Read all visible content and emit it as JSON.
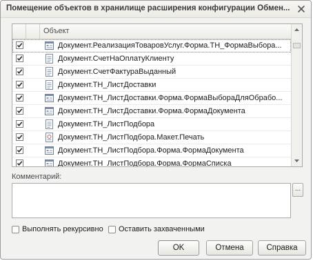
{
  "window": {
    "title": "Помещение объектов в хранилище расширения конфигурации Обмен..."
  },
  "grid": {
    "column_object": "Объект",
    "rows": [
      {
        "checked": true,
        "icon": "form-icon",
        "text": "Документ.РеализацияТоваровУслуг.Форма.ТН_ФормаВыбора..."
      },
      {
        "checked": true,
        "icon": "document-icon",
        "text": "Документ.СчетНаОплатуКлиенту"
      },
      {
        "checked": true,
        "icon": "document-icon",
        "text": "Документ.СчетФактураВыданный"
      },
      {
        "checked": true,
        "icon": "document-icon",
        "text": "Документ.ТН_ЛистДоставки"
      },
      {
        "checked": true,
        "icon": "form-icon",
        "text": "Документ.ТН_ЛистДоставки.Форма.ФормаВыбораДляОбрабо..."
      },
      {
        "checked": true,
        "icon": "form-icon",
        "text": "Документ.ТН_ЛистДоставки.Форма.ФормаДокумента"
      },
      {
        "checked": true,
        "icon": "document-icon",
        "text": "Документ.ТН_ЛистПодбора"
      },
      {
        "checked": true,
        "icon": "template-icon",
        "text": "Документ.ТН_ЛистПодбора.Макет.Печать"
      },
      {
        "checked": true,
        "icon": "form-icon",
        "text": "Документ.ТН_ЛистПодбора.Форма.ФормаДокумента"
      },
      {
        "checked": true,
        "icon": "form-icon",
        "text": "Документ.ТН_ЛистПодбора.Форма.ФормаСписка"
      }
    ]
  },
  "comment": {
    "label": "Комментарий:",
    "value": "",
    "ellipsis_label": "..."
  },
  "options": {
    "recursive_label": "Выполнять рекурсивно",
    "recursive_checked": false,
    "keep_captured_label": "Оставить захваченными",
    "keep_captured_checked": false
  },
  "buttons": {
    "ok": "OK",
    "cancel": "Отмена",
    "help": "Справка"
  }
}
